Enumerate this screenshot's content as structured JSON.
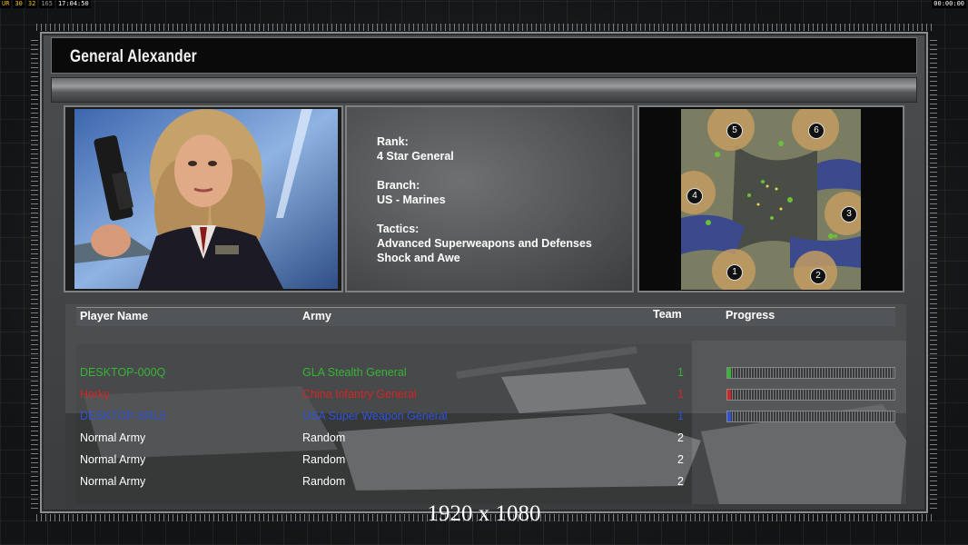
{
  "hud": {
    "left": [
      "UR",
      "30",
      "32",
      "165",
      "17:04:50"
    ],
    "right": "00:00:00"
  },
  "general": {
    "name": "General Alexander",
    "rank_label": "Rank:",
    "rank_value": "4 Star General",
    "branch_label": "Branch:",
    "branch_value": "US - Marines",
    "tactics_label": "Tactics:",
    "tactics_values": [
      "Advanced Superweapons and Defenses",
      "Shock and Awe"
    ]
  },
  "map": {
    "start_positions": [
      "1",
      "2",
      "3",
      "4",
      "5",
      "6"
    ]
  },
  "table": {
    "headers": {
      "player": "Player Name",
      "army": "Army",
      "team": "Team",
      "progress": "Progress"
    },
    "rows": [
      {
        "player": "DESKTOP-000Q",
        "army": "GLA Stealth General",
        "team": "1",
        "color": "#36b536",
        "progress": 0.02
      },
      {
        "player": "Herky",
        "army": "China Infantry General",
        "team": "1",
        "color": "#d42424",
        "progress": 0.01
      },
      {
        "player": "DESKTOP-SRL5",
        "army": "USA Super Weapon General",
        "team": "1",
        "color": "#2f52d8",
        "progress": 0.02
      },
      {
        "player": "Normal Army",
        "army": "Random",
        "team": "2",
        "color": "#ffffff",
        "progress": null
      },
      {
        "player": "Normal Army",
        "army": "Random",
        "team": "2",
        "color": "#ffffff",
        "progress": null
      },
      {
        "player": "Normal Army",
        "army": "Random",
        "team": "2",
        "color": "#ffffff",
        "progress": null
      }
    ]
  },
  "resolution_label": "1920 x 1080"
}
